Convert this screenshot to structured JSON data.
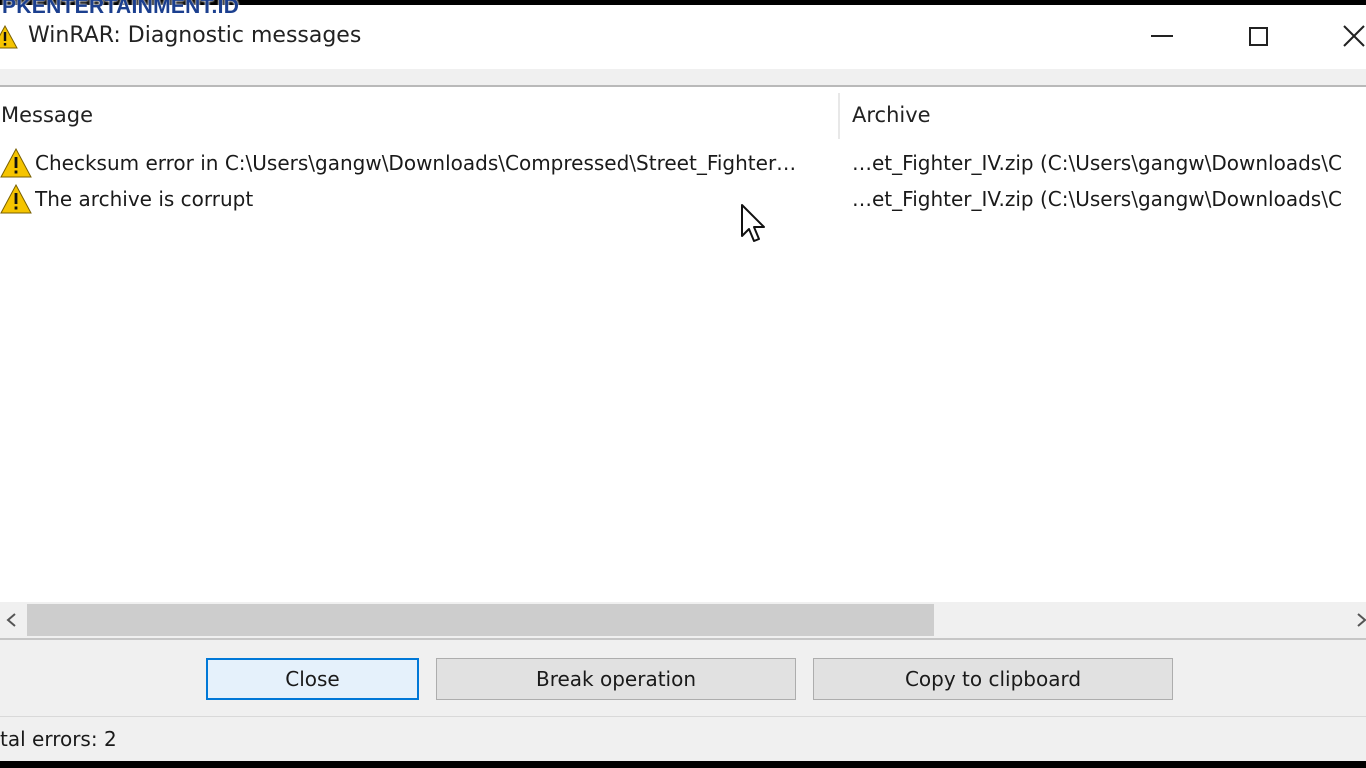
{
  "watermark": "PKENTERTAINMENT.ID",
  "window": {
    "title": "WinRAR: Diagnostic messages"
  },
  "columns": {
    "message": "Message",
    "archive": "Archive"
  },
  "rows": [
    {
      "icon": "warning-icon",
      "message": "Checksum error in C:\\Users\\gangw\\Downloads\\Compressed\\Street_Fighter…",
      "archive": "…et_Fighter_IV.zip (C:\\Users\\gangw\\Downloads\\C"
    },
    {
      "icon": "warning-icon",
      "message": "The archive is corrupt",
      "archive": "…et_Fighter_IV.zip (C:\\Users\\gangw\\Downloads\\C"
    }
  ],
  "buttons": {
    "close": "Close",
    "break": "Break operation",
    "copy": "Copy to clipboard"
  },
  "status": {
    "text": "tal errors: 2"
  },
  "colors": {
    "warning_yellow": "#f5c400",
    "default_button_border": "#0078d7",
    "watermark": "#1b3f8f"
  }
}
